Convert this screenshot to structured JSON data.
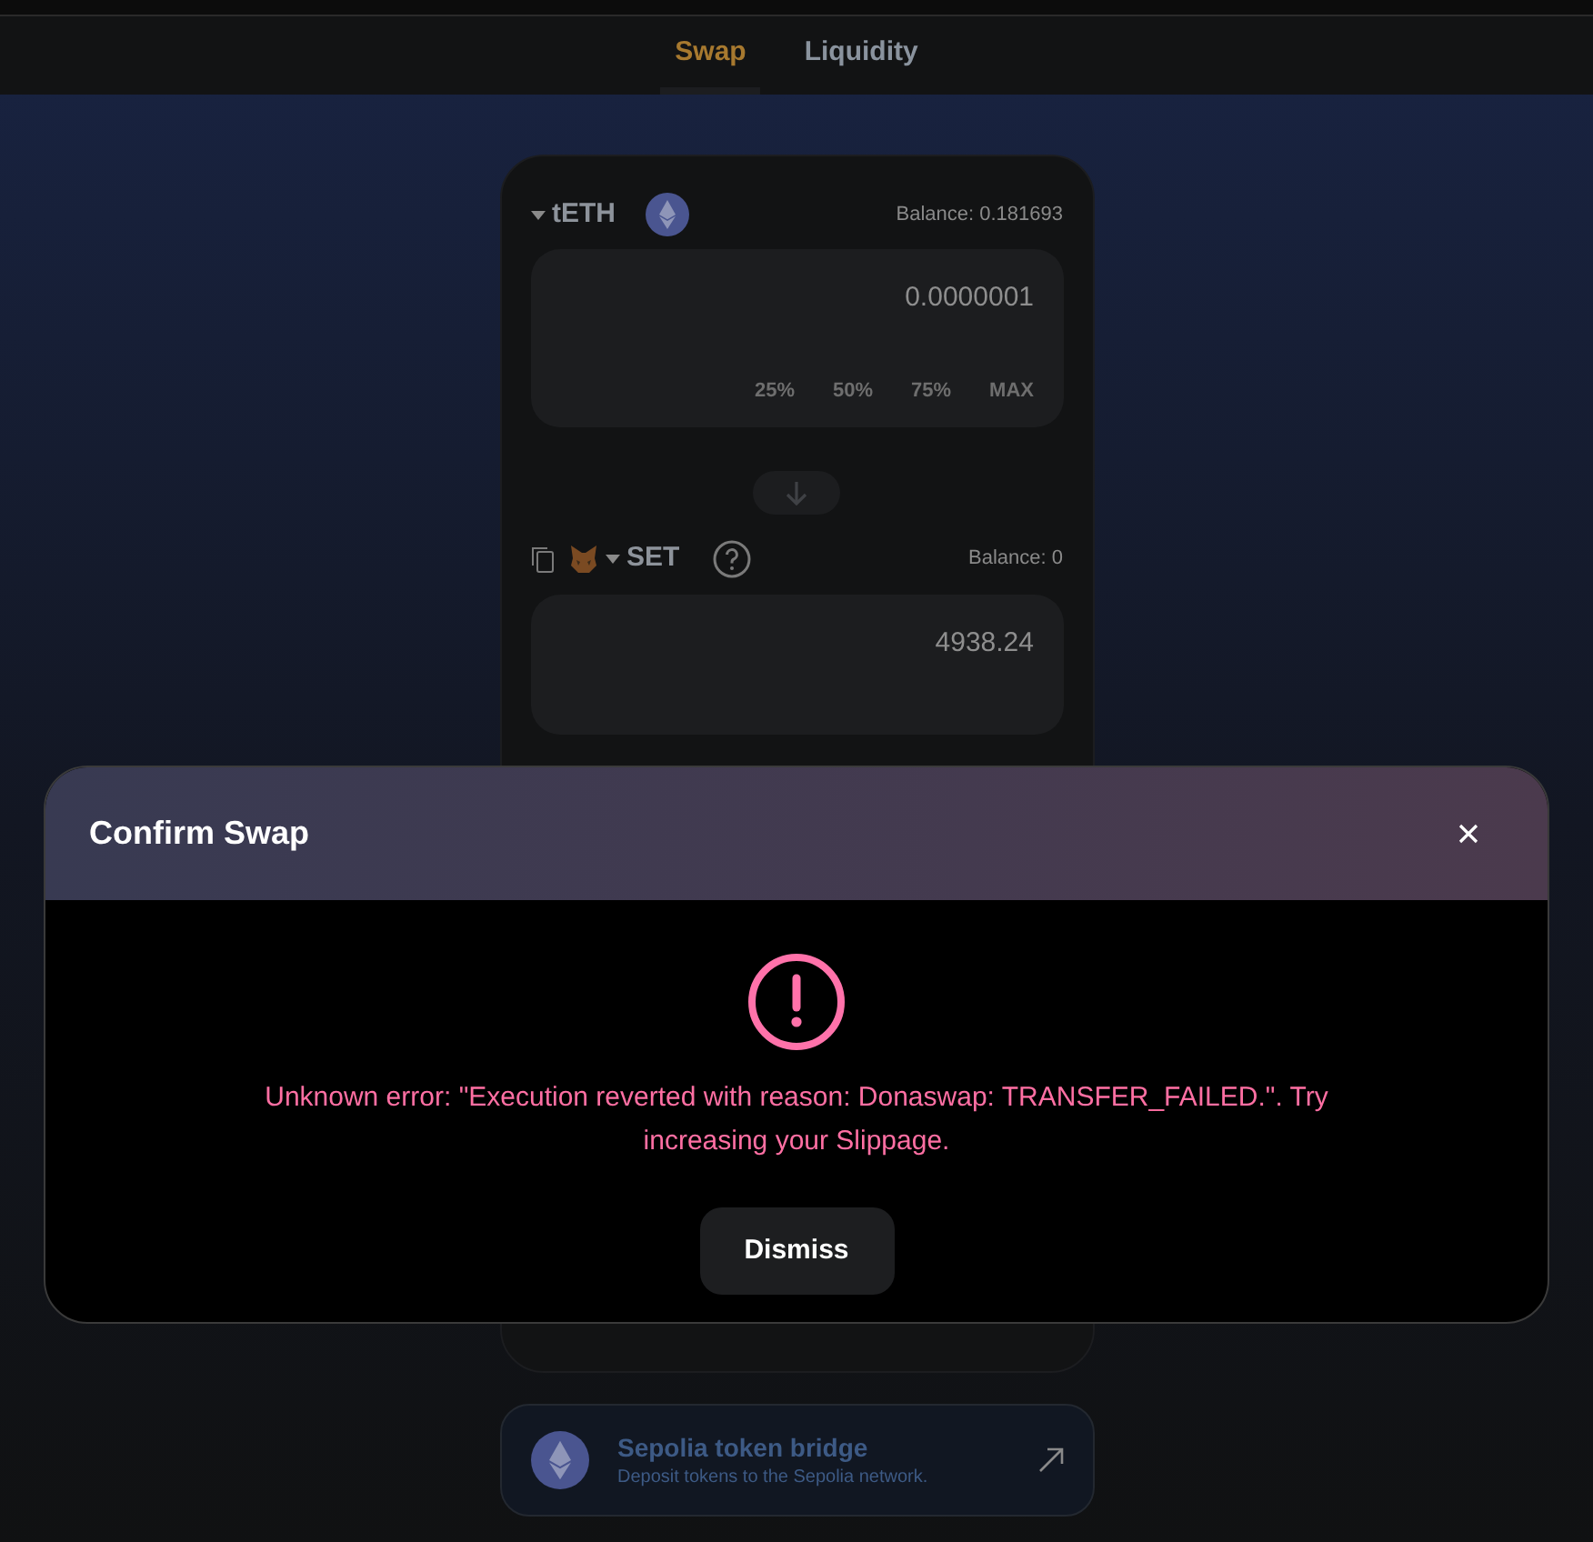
{
  "tabs": [
    {
      "label": "Swap",
      "selected": true
    },
    {
      "label": "Liquidity",
      "selected": false
    }
  ],
  "from": {
    "symbol": "tETH",
    "balance": "Balance: 0.181693",
    "amount": "0.0000001",
    "percent_buttons": [
      "25%",
      "50%",
      "75%",
      "MAX"
    ]
  },
  "to": {
    "symbol": "SET",
    "balance": "Balance: 0",
    "amount": "4938.24"
  },
  "bridge": {
    "title": "Sepolia token bridge",
    "subtitle": "Deposit tokens to the Sepolia network."
  },
  "modal": {
    "title": "Confirm Swap",
    "message": "Unknown error: \"Execution reverted with reason: Donaswap: TRANSFER_FAILED.\". Try increasing your Slippage.",
    "button": "Dismiss"
  }
}
